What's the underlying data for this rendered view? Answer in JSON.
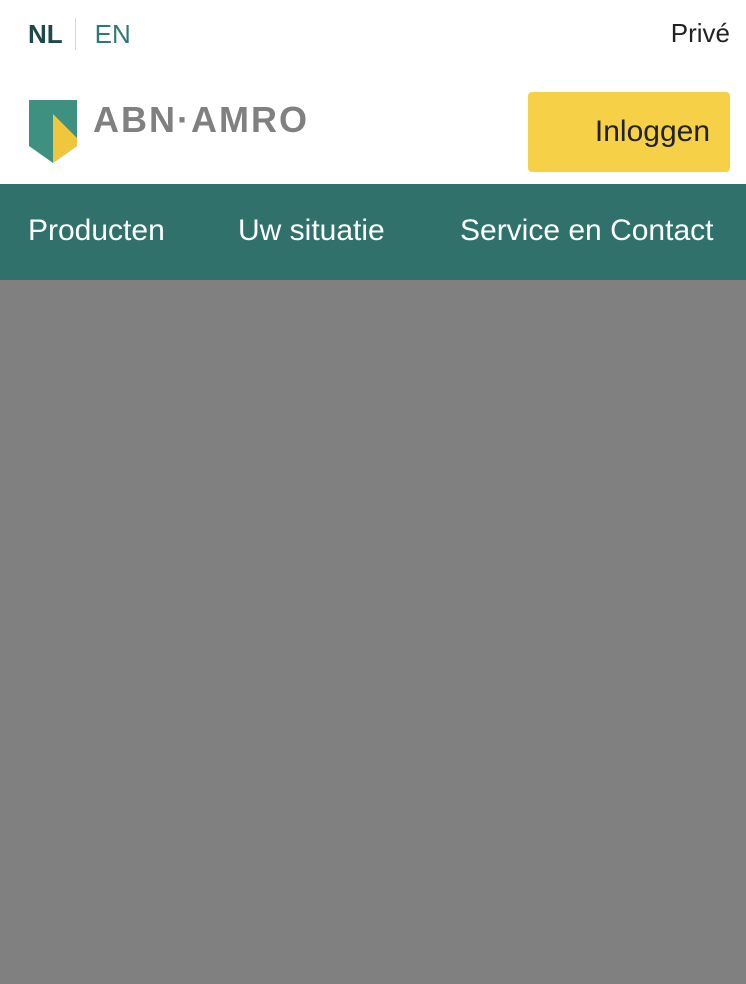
{
  "language_switch": {
    "active": "NL",
    "alternate": "EN"
  },
  "segment": {
    "label": "Privé"
  },
  "brand": {
    "logo_text": "ABN·AMRO",
    "shield_icon": "abn-amro-shield-icon",
    "colors": {
      "green": "#3e9081",
      "yellow": "#efc63c",
      "text_grey": "#808080"
    }
  },
  "header": {
    "login_label": "Inloggen",
    "login_color": "#f6d148"
  },
  "nav": {
    "background": "#30716c",
    "items": [
      {
        "label": "Producten"
      },
      {
        "label": "Uw situatie"
      },
      {
        "label": "Service en Contact"
      }
    ]
  },
  "content": {
    "background": "#808080"
  }
}
